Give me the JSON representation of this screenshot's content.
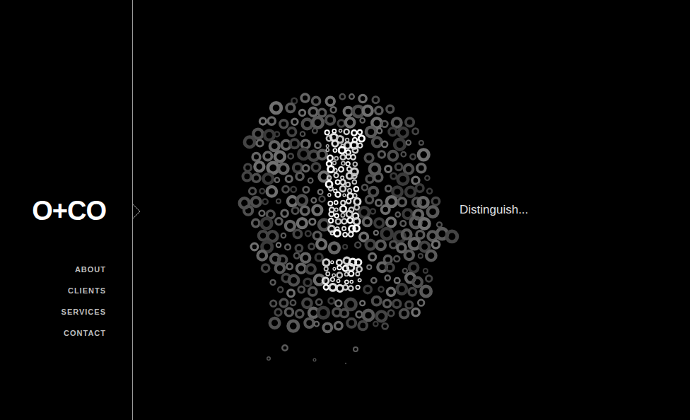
{
  "logo": "O+CO",
  "nav": [
    {
      "label": "ABOUT"
    },
    {
      "label": "CLIENTS"
    },
    {
      "label": "SERVICES"
    },
    {
      "label": "CONTACT"
    }
  ],
  "tagline": "Distinguish..."
}
